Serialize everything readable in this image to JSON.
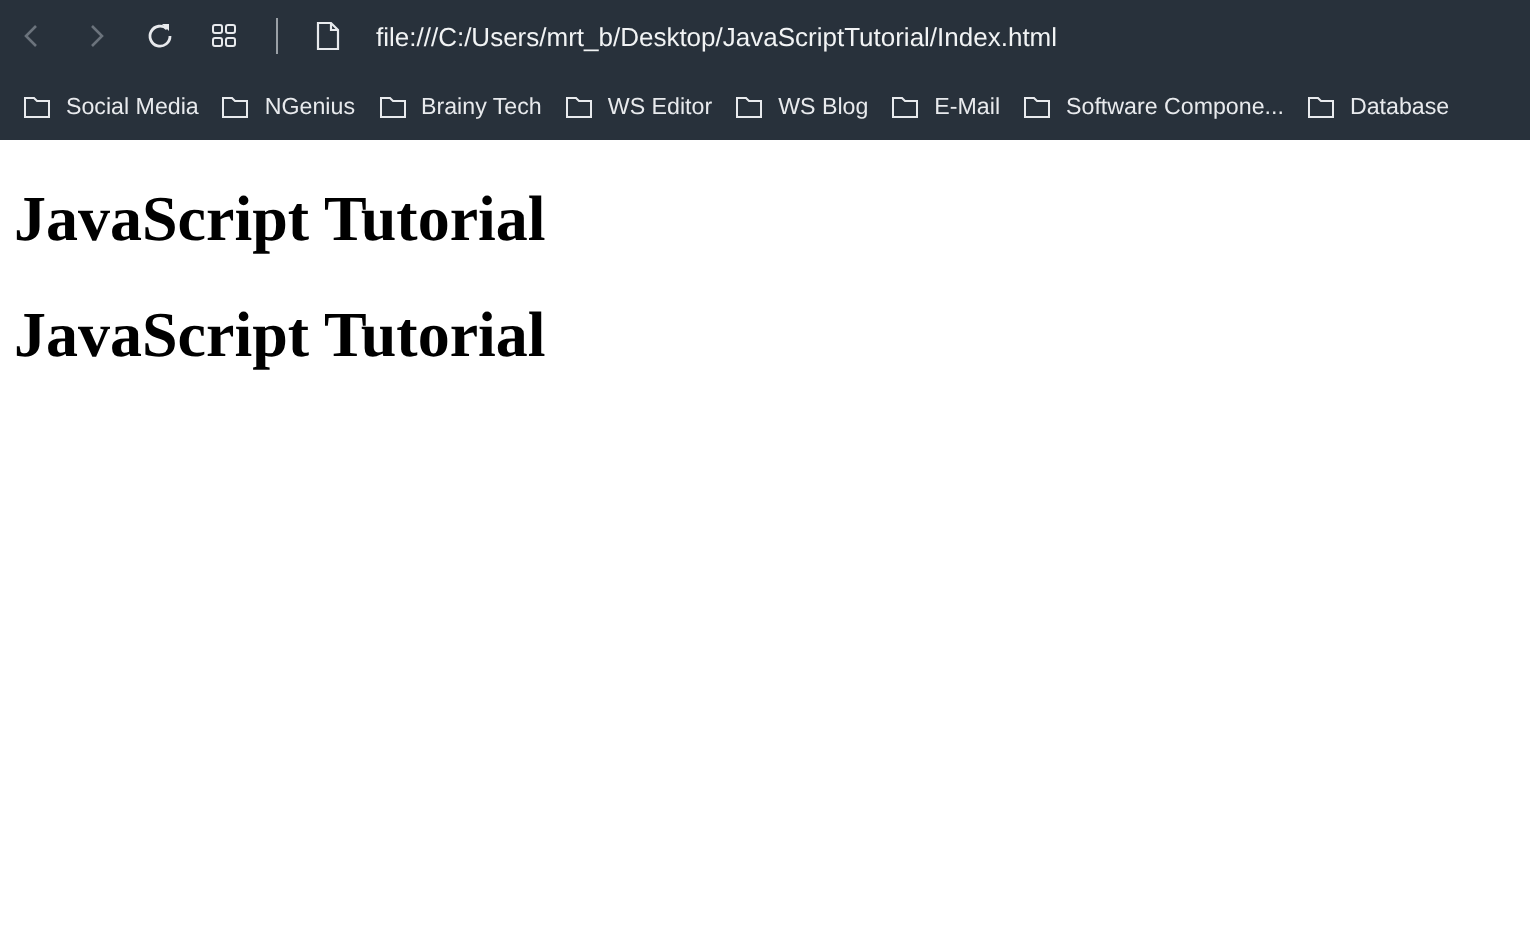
{
  "toolbar": {
    "nav_buttons": [
      {
        "kind": "back",
        "disabled": true
      },
      {
        "kind": "forward",
        "disabled": true
      },
      {
        "kind": "reload",
        "disabled": false
      },
      {
        "kind": "tabs",
        "disabled": false
      }
    ],
    "address": "file:///C:/Users/mrt_b/Desktop/JavaScriptTutorial/Index.html"
  },
  "bookmarks": [
    {
      "label": "Social Media"
    },
    {
      "label": "NGenius"
    },
    {
      "label": "Brainy Tech"
    },
    {
      "label": "WS Editor"
    },
    {
      "label": "WS Blog"
    },
    {
      "label": "E-Mail"
    },
    {
      "label": "Software Compone..."
    },
    {
      "label": "Database"
    }
  ],
  "page": {
    "headings": [
      "JavaScript Tutorial",
      "JavaScript Tutorial"
    ]
  }
}
